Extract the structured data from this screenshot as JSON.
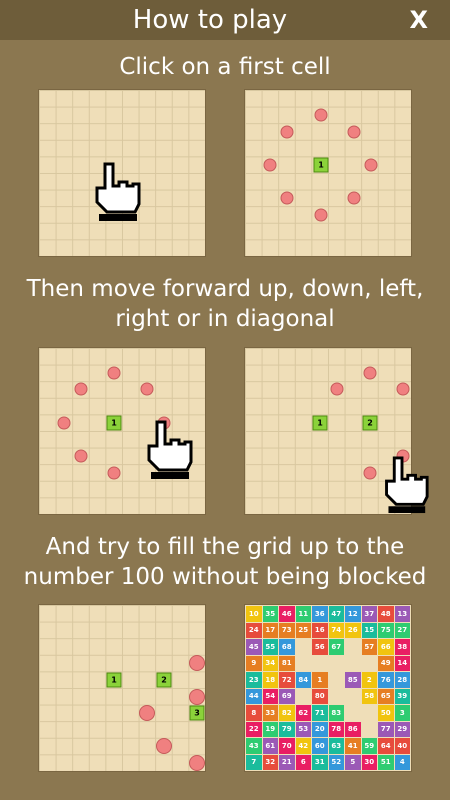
{
  "header": {
    "title": "How to play",
    "close_label": "X"
  },
  "captions": {
    "step1": "Click on a first cell",
    "step2": "Then move forward up, down, left,\nright or in diagonal",
    "step3": "And try to fill the grid up to the\nnumber 100 without being blocked"
  },
  "cells": {
    "one": "1",
    "two": "2",
    "three": "3"
  },
  "icons": {
    "hand": "pointing-hand-icon"
  },
  "colors": {
    "dot": "#f08080",
    "cell": "#8bd23a",
    "board": "#efdeb8",
    "background": "#8b7750"
  },
  "final_grid": [
    [
      "10",
      "35",
      "46",
      "11",
      "36",
      "47",
      "12",
      "37",
      "48",
      "13"
    ],
    [
      "24",
      "17",
      "73",
      "25",
      "16",
      "74",
      "26",
      "15",
      "75",
      "27"
    ],
    [
      "45",
      "55",
      "68",
      "",
      "56",
      "67",
      "",
      "57",
      "66",
      "38"
    ],
    [
      "9",
      "34",
      "81",
      "",
      "",
      "",
      "",
      "",
      "49",
      "14"
    ],
    [
      "23",
      "18",
      "72",
      "84",
      "1",
      "",
      "85",
      "2",
      "76",
      "28"
    ],
    [
      "44",
      "54",
      "69",
      "",
      "80",
      "",
      "",
      "58",
      "65",
      "39"
    ],
    [
      "8",
      "33",
      "82",
      "62",
      "71",
      "83",
      "",
      "",
      "50",
      "3"
    ],
    [
      "22",
      "19",
      "79",
      "53",
      "20",
      "78",
      "86",
      "",
      "77",
      "29"
    ],
    [
      "43",
      "61",
      "70",
      "42",
      "60",
      "63",
      "41",
      "59",
      "64",
      "40"
    ],
    [
      "7",
      "32",
      "21",
      "6",
      "31",
      "52",
      "5",
      "30",
      "51",
      "4"
    ]
  ]
}
